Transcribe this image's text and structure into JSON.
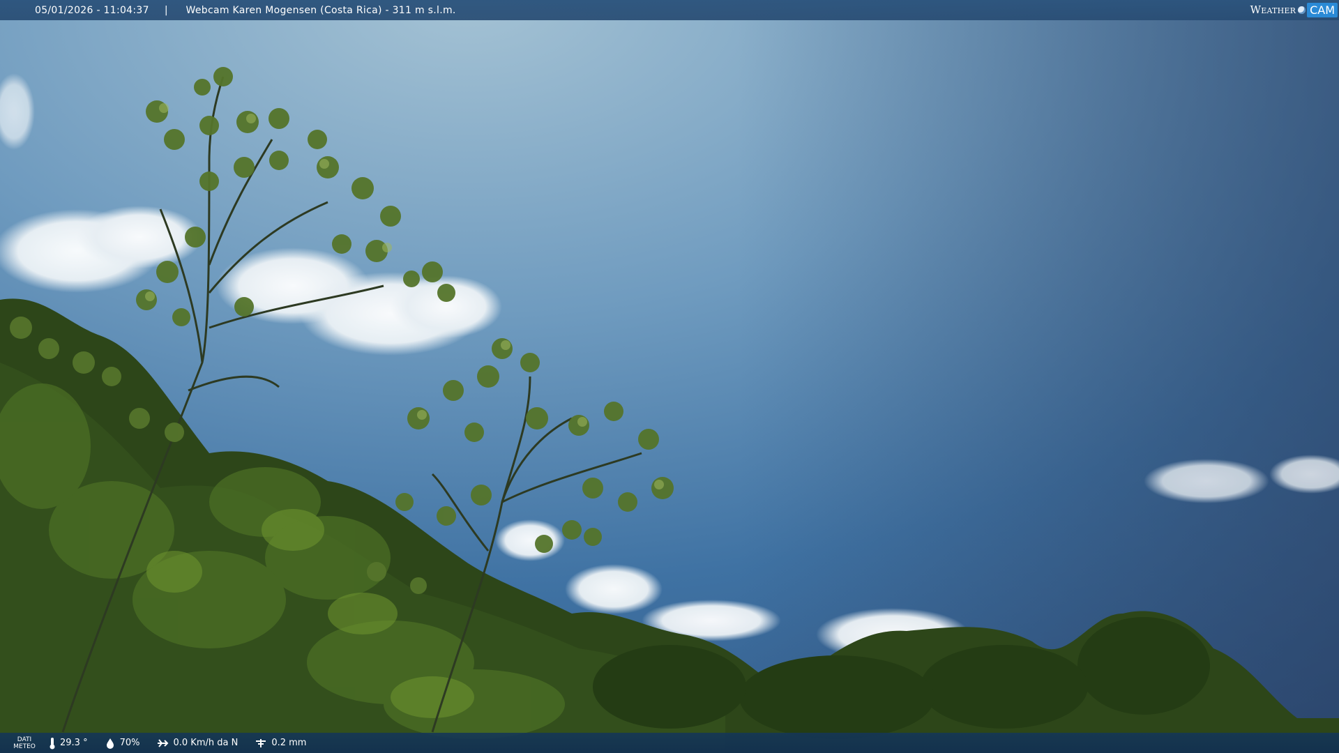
{
  "header": {
    "timestamp": "05/01/2026 - 11:04:37",
    "separator": "|",
    "title": "Webcam Karen Mogensen (Costa Rica) - 311 m s.l.m.",
    "logo_weather": "Weather",
    "logo_cam": "CAM"
  },
  "footer": {
    "label_line1": "DATI",
    "label_line2": "METEO",
    "temperature": "29.3 °",
    "humidity": "70%",
    "wind": "0.0 Km/h da N",
    "rain": "0.2 mm"
  },
  "icons": {
    "temperature": "thermometer-icon",
    "humidity": "humidity-drop-icon",
    "wind": "wind-icon",
    "rain": "rain-gauge-icon"
  },
  "colors": {
    "sky_top": "#8fb3cb",
    "sky_right": "#36557e",
    "foliage": "#2f4a1b",
    "bar": "#2c547d"
  }
}
